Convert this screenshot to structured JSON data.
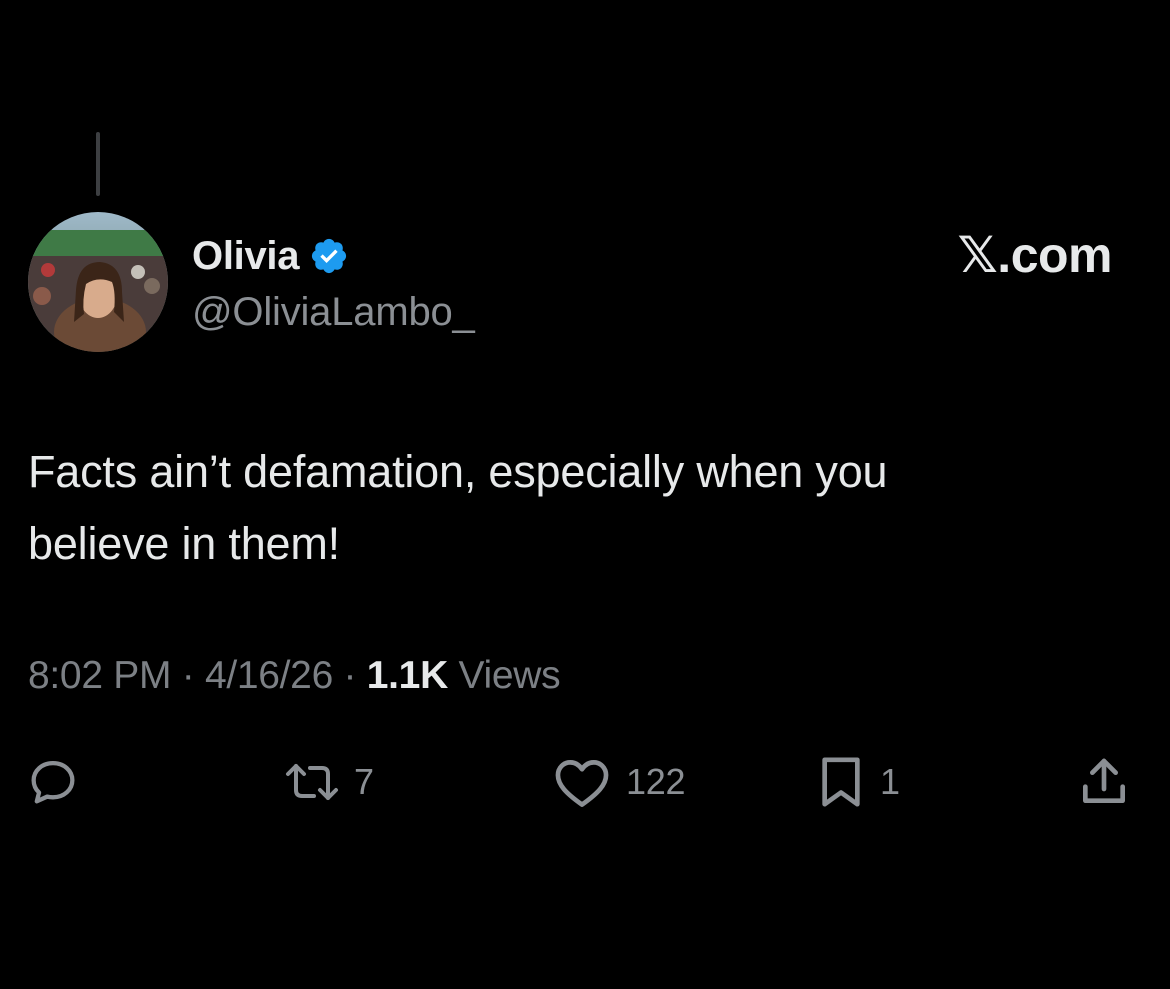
{
  "author": {
    "display_name": "Olivia",
    "handle": "@OliviaLambo_",
    "verified": true
  },
  "brand": "𝕏.com",
  "tweet": {
    "line1": "Facts ain’t defamation, especially when you",
    "line2": "believe in them!",
    "time": "8:02 PM",
    "date": "4/16/26",
    "sep": "·",
    "views_count": "1.1K",
    "views_label": "Views"
  },
  "actions": {
    "reply_count": "",
    "repost_count": "7",
    "like_count": "122",
    "bookmark_count": "1"
  },
  "icons": {
    "reply": "reply-icon",
    "repost": "repost-icon",
    "like": "heart-icon",
    "bookmark": "bookmark-icon",
    "share": "share-icon",
    "verified": "verified-badge-icon"
  },
  "colors": {
    "background": "#000000",
    "text_primary": "#e7e9ea",
    "text_secondary": "#8b8f94",
    "verified_blue": "#1d9bf0"
  }
}
